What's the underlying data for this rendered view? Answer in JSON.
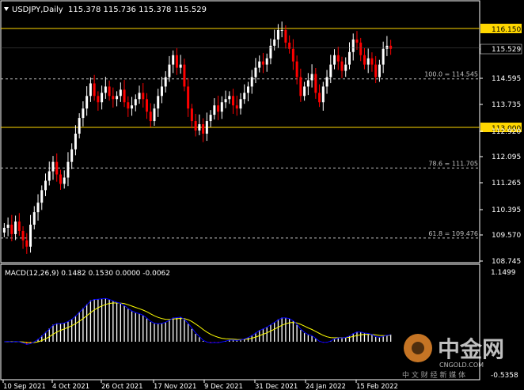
{
  "header": {
    "symbol": "USDJPY,Daily",
    "ohlc": "115.378 115.736 115.378 115.529",
    "menu_icon": "triangle-down-icon"
  },
  "colors": {
    "background": "#000000",
    "up_candle": "#ffffff",
    "down_candle": "#ff0000",
    "level_line": "#ffd700",
    "fib_line": "#c0c0c0",
    "macd_line": "#ffff00",
    "signal_line": "#0000ff",
    "hist_pos": "#ffffff",
    "hist_neg": "#ff0000"
  },
  "price_axis": {
    "ticks": [
      "116.150",
      "115.529",
      "114.595",
      "113.735",
      "112.920",
      "112.095",
      "111.265",
      "110.395",
      "109.570",
      "108.745"
    ],
    "current": "115.529"
  },
  "levels": [
    {
      "price": 116.15,
      "label": "116.150"
    },
    {
      "price": 113.0,
      "label": "113.000"
    }
  ],
  "fib_levels": [
    {
      "price": 114.545,
      "label": "100.0 = 114.545"
    },
    {
      "price": 111.705,
      "label": "78.6 = 111.705"
    },
    {
      "price": 109.476,
      "label": "61.8 = 109.476"
    }
  ],
  "macd": {
    "title": "MACD(12,26,9) 0.1482 0.1530 0.0000 -0.0062",
    "axis_ticks": [
      "1.1499",
      "-0.5358"
    ]
  },
  "time_axis": [
    "10 Sep 2021",
    "4 Oct 2021",
    "26 Oct 2021",
    "17 Nov 2021",
    "9 Dec 2021",
    "31 Dec 2021",
    "24 Jan 2022",
    "15 Feb 2022"
  ],
  "watermark": {
    "brand": "中金网",
    "sub": "CNGOLD.COM",
    "tagline": "中 文 财 经 新 媒 体"
  },
  "chart_data": {
    "type": "candlestick",
    "title": "USDJPY,Daily",
    "ylim": [
      108.6,
      116.6
    ],
    "closes": [
      109.8,
      109.9,
      109.6,
      110.0,
      109.7,
      109.4,
      109.2,
      109.9,
      110.3,
      110.6,
      111.0,
      111.3,
      111.6,
      111.9,
      111.5,
      111.2,
      111.4,
      111.9,
      112.3,
      112.8,
      113.3,
      113.6,
      114.0,
      114.4,
      114.0,
      113.8,
      114.1,
      114.3,
      114.0,
      113.9,
      114.0,
      114.2,
      113.8,
      113.6,
      113.7,
      113.9,
      114.1,
      113.9,
      113.5,
      113.2,
      113.6,
      114.0,
      114.3,
      114.6,
      115.0,
      115.3,
      114.9,
      115.0,
      114.3,
      113.6,
      113.2,
      112.9,
      113.1,
      112.8,
      113.2,
      113.4,
      113.7,
      113.5,
      113.8,
      113.9,
      114.0,
      113.7,
      113.6,
      113.9,
      114.1,
      114.3,
      114.6,
      114.9,
      115.1,
      115.0,
      115.2,
      115.6,
      115.8,
      116.1,
      116.1,
      115.7,
      115.5,
      115.1,
      114.6,
      114.0,
      114.3,
      114.5,
      114.7,
      114.1,
      113.8,
      114.3,
      114.6,
      115.0,
      115.3,
      115.1,
      114.8,
      115.0,
      115.4,
      115.8,
      115.7,
      115.3,
      115.0,
      115.2,
      115.0,
      114.6,
      115.0,
      115.5,
      115.6,
      115.5
    ]
  }
}
